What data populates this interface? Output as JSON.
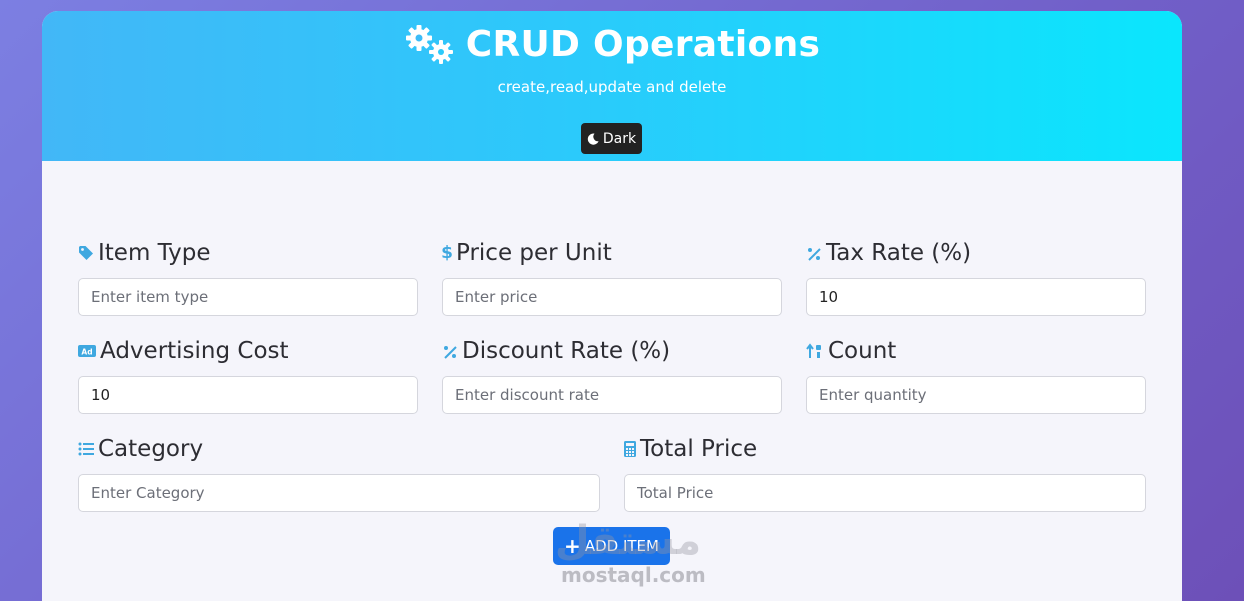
{
  "header": {
    "title": "CRUD Operations",
    "subtitle": "create,read,update and delete",
    "theme_button_label": "Dark"
  },
  "fields": {
    "item_type": {
      "label": "Item Type",
      "placeholder": "Enter item type",
      "value": ""
    },
    "price_per_unit": {
      "label": "Price per Unit",
      "placeholder": "Enter price",
      "value": ""
    },
    "tax_rate": {
      "label": "Tax Rate (%)",
      "placeholder": "",
      "value": "10"
    },
    "advertising_cost": {
      "label": "Advertising Cost",
      "placeholder": "",
      "value": "10"
    },
    "discount_rate": {
      "label": "Discount Rate (%)",
      "placeholder": "Enter discount rate",
      "value": ""
    },
    "count": {
      "label": "Count",
      "placeholder": "Enter quantity",
      "value": ""
    },
    "category": {
      "label": "Category",
      "placeholder": "Enter Category",
      "value": ""
    },
    "total_price": {
      "label": "Total Price",
      "placeholder": "Total Price",
      "value": ""
    }
  },
  "actions": {
    "add_label": "ADD ITEM"
  },
  "watermark": {
    "arabic": "مستقل",
    "latin": "mostaql.com"
  },
  "colors": {
    "accent_icon": "#3fa8e0",
    "primary_button": "#1a73ea",
    "header_start": "#42b7f7",
    "header_end": "#0ae6fd"
  },
  "icons": {
    "title": "gears-icon",
    "theme": "moon-icon",
    "item_type": "tag-icon",
    "price_per_unit": "dollar-icon",
    "tax_rate": "percent-icon",
    "advertising_cost": "ad-icon",
    "discount_rate": "percent-icon",
    "count": "sort-numeric-icon",
    "category": "list-icon",
    "total_price": "calculator-icon",
    "add": "plus-icon"
  }
}
